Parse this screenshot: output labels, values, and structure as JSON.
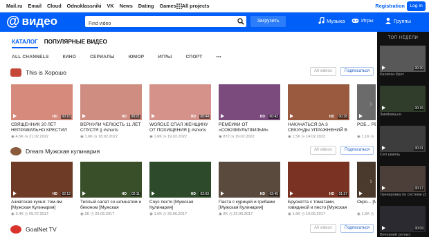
{
  "topbar": {
    "links": [
      "Mail.ru",
      "Email",
      "Cloud",
      "Odnoklassniki",
      "VK",
      "News",
      "Dating",
      "Games",
      "All projects"
    ],
    "registration": "Registration",
    "login": "Log in"
  },
  "header": {
    "logo_text": "видео",
    "search_placeholder": "Find video",
    "upload": "Загрузить",
    "nav": [
      "Музыка",
      "Игры",
      "Группы"
    ]
  },
  "tabs": [
    "КАТАЛОГ",
    "ПОПУЛЯРНЫЕ ВИДЕО"
  ],
  "categories": [
    "ALL CHANNELS",
    "КИНО",
    "СЕРИАЛЫ",
    "ЮМОР",
    "ИГРЫ",
    "СПОРТ",
    "•••"
  ],
  "buttons": {
    "all_videos": "All videos",
    "subscribe": "Подписаться"
  },
  "sections": [
    {
      "channel": "This is Хорошо",
      "videos": [
        {
          "title": "СВЯЩЕННИК 20 ЛЕТ НЕПРАВИЛЬНО КРЕСТИЛ",
          "views": "4.5K",
          "date": "21.02.2022",
          "hd": "HD",
          "dur": "00:16",
          "thumb": "#d68a7c"
        },
        {
          "title": "ВЕРНУЛИ ЧЕЛЮСТЬ 11 ЛЕТ СПУСТЯ || #shorts",
          "views": "1.6K",
          "date": "18.02.2022",
          "hd": "HD",
          "dur": "00:21",
          "thumb": "#cf8d82"
        },
        {
          "title": "WORDLE СПАЛ ЖЕНЩИНУ ОТ ПОХИЩЕНИЯ || #shorts",
          "views": "1.6K",
          "date": "19.02.2022",
          "hd": "HD",
          "dur": "00:44",
          "thumb": "#d4928a"
        },
        {
          "title": "РЕМЕЙКИ ОТ «СОЮЗМУЛЬТФИЛЬМ»",
          "views": "872",
          "date": "19.02.2022",
          "hd": "HD",
          "dur": "00:42",
          "thumb": "#7a4b7c"
        },
        {
          "title": "НАКАЧАТЬСЯ ЗА 3 СЕКУНДЫ УПРАЖНЕНИЙ В ДЕНЬ",
          "views": "1.5K",
          "date": "14.02.2022",
          "hd": "HD",
          "dur": "00:38",
          "thumb": "#9a5a3f"
        },
        {
          "title": "РОБ... РЕК...",
          "views": "1.1K",
          "date": "",
          "hd": "",
          "dur": "",
          "thumb": "#6b6b6b"
        }
      ]
    },
    {
      "channel": "Dream Мужская кулинария",
      "videos": [
        {
          "title": "Азиатская кухня: том-ям [Мужская Кулинария]",
          "views": "3.4K",
          "date": "05.07.2017",
          "hd": "HD",
          "dur": "02:12",
          "thumb": "#6e3b26"
        },
        {
          "title": "Теплый салат со шпинатом и беконом [Мужская Кулинария]",
          "views": "2K",
          "date": "29.06.2017",
          "hd": "HD",
          "dur": "02:11",
          "thumb": "#394f2a"
        },
        {
          "title": "Соус песто [Мужская Кулинария]",
          "views": "1.6K",
          "date": "26.06.2017",
          "hd": "HD",
          "dur": "02:03",
          "thumb": "#2d4a2a"
        },
        {
          "title": "Паста с курицей и грибами [Мужская Кулинария]",
          "views": "2K",
          "date": "22.06.2017",
          "hd": "HD",
          "dur": "02:45",
          "thumb": "#5a4a3e"
        },
        {
          "title": "Брускетта с томатами, говядиной и песто [Мужская Кулинария]",
          "views": "1.6K",
          "date": "19.06.2017",
          "hd": "HD",
          "dur": "01:37",
          "thumb": "#7a3323"
        },
        {
          "title": "Окро... [Муж...",
          "views": "1.5K",
          "date": "",
          "hd": "",
          "dur": "",
          "thumb": "#4a3a2e"
        }
      ]
    },
    {
      "channel": "GoalNet TV",
      "videos": []
    }
  ],
  "sidebar": {
    "title": "ТОП НЕДЕЛИ",
    "items": [
      {
        "caption": "Калитан Крот",
        "dur": "00:30",
        "thumb": "#585858"
      },
      {
        "caption": "Змейкиньсе",
        "dur": "00:15",
        "thumb": "#2f3d2a"
      },
      {
        "caption": "Сел шмель",
        "dur": "00:31",
        "thumb": "#3d3d3d"
      },
      {
        "caption": "Тренировка по системе Джеймса",
        "dur": "00:17",
        "thumb": "#4c3f39"
      },
      {
        "caption": "Вечерний релакс",
        "dur": "00:09",
        "thumb": "#2a2a30"
      }
    ]
  },
  "colors": {
    "accent": "#005ff9",
    "header": "#005ff9",
    "sidebar": "#111111"
  }
}
